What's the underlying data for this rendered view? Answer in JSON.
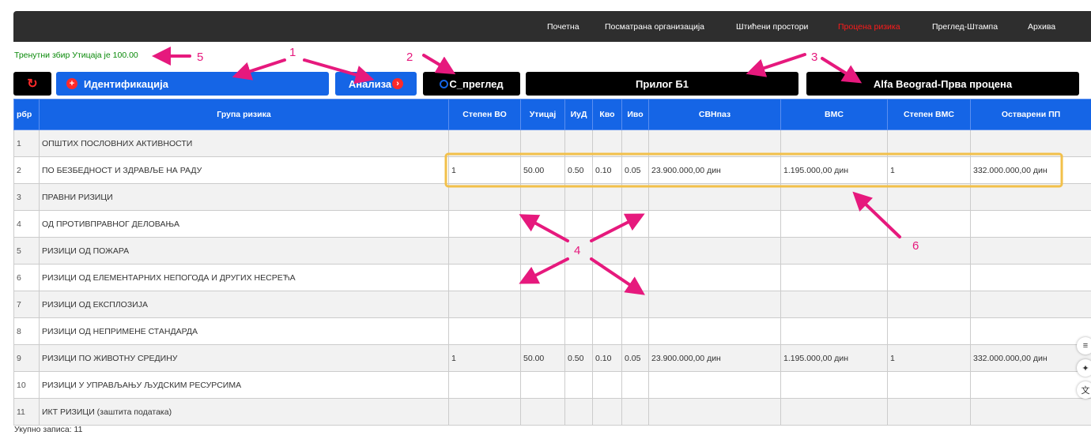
{
  "nav": {
    "items": [
      "Почетна",
      "Посматрана организација",
      "Штићени простори",
      "Процена ризика",
      "Преглед-Штампа",
      "Архива"
    ],
    "active_index": 3
  },
  "sum_text": "Тренутни збир Утицаја је 100.00",
  "buttons": {
    "refresh_icon": "refresh-icon",
    "identifikacija": "Идентификација",
    "analiza": "Анализа",
    "c_pregled": "C_преглед",
    "prilog": "Прилог Б1",
    "alfa": "Alfa Beograd-Прва процена"
  },
  "table": {
    "columns": [
      "рбр",
      "Група ризика",
      "Степен ВО",
      "Утицај",
      "ИуД",
      "Кво",
      "Иво",
      "СВНпаз",
      "ВМС",
      "Степен ВМС",
      "Остварени ПП"
    ],
    "rows": [
      [
        "1",
        "ОПШТИХ ПОСЛОВНИХ АКТИВНОСТИ",
        "",
        "",
        "",
        "",
        "",
        "",
        "",
        "",
        ""
      ],
      [
        "2",
        "ПО БЕЗБЕДНОСТ И ЗДРАВЉЕ НА РАДУ",
        "1",
        "50.00",
        "0.50",
        "0.10",
        "0.05",
        "23.900.000,00 дин",
        "1.195.000,00 дин",
        "1",
        "332.000.000,00 дин"
      ],
      [
        "3",
        "ПРАВНИ РИЗИЦИ",
        "",
        "",
        "",
        "",
        "",
        "",
        "",
        "",
        ""
      ],
      [
        "4",
        "ОД ПРОТИВПРАВНОГ ДЕЛОВАЊА",
        "",
        "",
        "",
        "",
        "",
        "",
        "",
        "",
        ""
      ],
      [
        "5",
        "РИЗИЦИ ОД ПОЖАРА",
        "",
        "",
        "",
        "",
        "",
        "",
        "",
        "",
        ""
      ],
      [
        "6",
        "РИЗИЦИ ОД ЕЛЕМЕНТАРНИХ НЕПОГОДА И ДРУГИХ НЕСРЕЋА",
        "",
        "",
        "",
        "",
        "",
        "",
        "",
        "",
        ""
      ],
      [
        "7",
        "РИЗИЦИ ОД ЕКСПЛОЗИЈА",
        "",
        "",
        "",
        "",
        "",
        "",
        "",
        "",
        ""
      ],
      [
        "8",
        "РИЗИЦИ ОД НЕПРИМЕНЕ СТАНДАРДА",
        "",
        "",
        "",
        "",
        "",
        "",
        "",
        "",
        ""
      ],
      [
        "9",
        "РИЗИЦИ ПО ЖИВОТНУ СРЕДИНУ",
        "1",
        "50.00",
        "0.50",
        "0.10",
        "0.05",
        "23.900.000,00 дин",
        "1.195.000,00 дин",
        "1",
        "332.000.000,00 дин"
      ],
      [
        "10",
        "РИЗИЦИ У УПРАВЉАЊУ ЉУДСКИМ РЕСУРСИМА",
        "",
        "",
        "",
        "",
        "",
        "",
        "",
        "",
        ""
      ],
      [
        "11",
        "ИКТ РИЗИЦИ (заштита података)",
        "",
        "",
        "",
        "",
        "",
        "",
        "",
        "",
        ""
      ]
    ]
  },
  "footer": {
    "count_text": "Укупно записа: 11"
  },
  "annotations": {
    "labels": [
      "1",
      "2",
      "3",
      "4",
      "5",
      "6"
    ],
    "color": "#e6197d",
    "highlight_color": "#f2c04a"
  },
  "side_icons": [
    "notes-icon",
    "sparkle-icon",
    "translate-icon"
  ]
}
